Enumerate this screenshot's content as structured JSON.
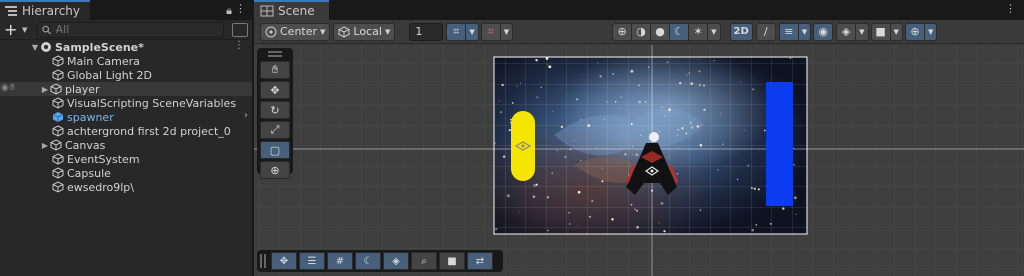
{
  "hierarchy": {
    "tab_title": "Hierarchy",
    "search_placeholder": "All",
    "items": [
      {
        "label": "SampleScene*",
        "depth": 0,
        "expanded": true,
        "type": "scene"
      },
      {
        "label": "Main Camera",
        "depth": 1,
        "type": "object"
      },
      {
        "label": "Global Light 2D",
        "depth": 1,
        "type": "object"
      },
      {
        "label": "player",
        "depth": 1,
        "type": "object",
        "collapsed": true
      },
      {
        "label": "VisualScripting SceneVariables",
        "depth": 1,
        "type": "object"
      },
      {
        "label": "spawner",
        "depth": 1,
        "type": "prefab",
        "selected": true
      },
      {
        "label": "achtergrond first 2d project_0",
        "depth": 1,
        "type": "object"
      },
      {
        "label": "Canvas",
        "depth": 1,
        "type": "object",
        "collapsed": true
      },
      {
        "label": "EventSystem",
        "depth": 1,
        "type": "object"
      },
      {
        "label": "Capsule",
        "depth": 1,
        "type": "object"
      },
      {
        "label": "ewsedro9lp\\",
        "depth": 1,
        "type": "object"
      }
    ]
  },
  "scene": {
    "tab_title": "Scene",
    "pivot_mode": "Center",
    "pivot_rotation": "Local",
    "grid_size_value": "1",
    "mode_2d_label": "2D"
  },
  "colors": {
    "accent": "#3a79bb",
    "selected_tool": "#46607c",
    "capsule": "#f5e500",
    "blue_bar": "#0b3cf0"
  }
}
